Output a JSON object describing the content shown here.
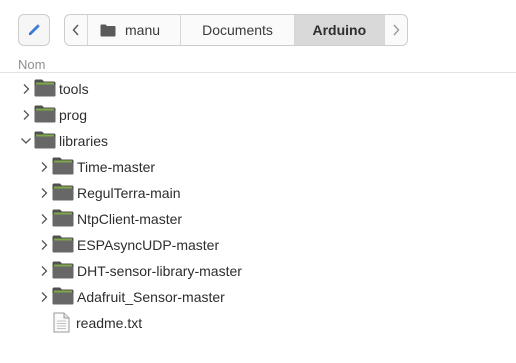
{
  "colors": {
    "folder_front": "#676767",
    "folder_back": "#505050",
    "folder_tab": "#7fa84a",
    "active_crumb": "#d9d9d9"
  },
  "toolbar": {
    "edit_icon": "pencil-icon",
    "back_icon": "chevron-left-icon",
    "forward_icon": "chevron-right-icon"
  },
  "pathbar": {
    "home": {
      "label": "manu",
      "icon": "folder-icon"
    },
    "crumbs": [
      "Documents",
      "Arduino"
    ],
    "active_crumb": "Arduino"
  },
  "list": {
    "column_header": "Nom",
    "rows": [
      {
        "name": "tools",
        "type": "folder",
        "depth": 0,
        "expanded": false
      },
      {
        "name": "prog",
        "type": "folder",
        "depth": 0,
        "expanded": false
      },
      {
        "name": "libraries",
        "type": "folder",
        "depth": 0,
        "expanded": true
      },
      {
        "name": "Time-master",
        "type": "folder",
        "depth": 1,
        "expanded": false
      },
      {
        "name": "RegulTerra-main",
        "type": "folder",
        "depth": 1,
        "expanded": false
      },
      {
        "name": "NtpClient-master",
        "type": "folder",
        "depth": 1,
        "expanded": false
      },
      {
        "name": "ESPAsyncUDP-master",
        "type": "folder",
        "depth": 1,
        "expanded": false
      },
      {
        "name": "DHT-sensor-library-master",
        "type": "folder",
        "depth": 1,
        "expanded": false
      },
      {
        "name": "Adafruit_Sensor-master",
        "type": "folder",
        "depth": 1,
        "expanded": false
      },
      {
        "name": "readme.txt",
        "type": "file",
        "depth": 1,
        "expanded": false
      }
    ]
  }
}
